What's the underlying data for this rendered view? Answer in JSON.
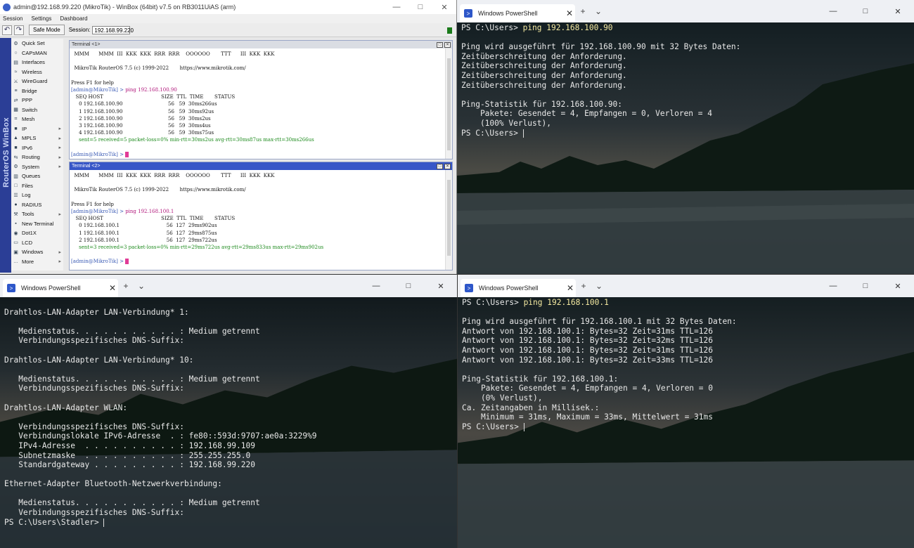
{
  "winbox": {
    "title": "admin@192.168.99.220 (MikroTik) - WinBox (64bit) v7.5 on RB3011UiAS (arm)",
    "menu": [
      "Session",
      "Settings",
      "Dashboard"
    ],
    "safe_mode_label": "Safe Mode",
    "session_label": "Session:",
    "session_value": "192.168.99.220",
    "vertical_label": "RouterOS WinBox",
    "sidebar": [
      {
        "label": "Quick Set",
        "icon": "quick-set-icon"
      },
      {
        "label": "CAPsMAN",
        "icon": "capsman-icon"
      },
      {
        "label": "Interfaces",
        "icon": "interfaces-icon"
      },
      {
        "label": "Wireless",
        "icon": "wireless-icon"
      },
      {
        "label": "WireGuard",
        "icon": "wireguard-icon"
      },
      {
        "label": "Bridge",
        "icon": "bridge-icon"
      },
      {
        "label": "PPP",
        "icon": "ppp-icon"
      },
      {
        "label": "Switch",
        "icon": "switch-icon"
      },
      {
        "label": "Mesh",
        "icon": "mesh-icon"
      },
      {
        "label": "IP",
        "icon": "ip-icon",
        "arrow": true
      },
      {
        "label": "MPLS",
        "icon": "mpls-icon",
        "arrow": true
      },
      {
        "label": "IPv6",
        "icon": "ipv6-icon",
        "arrow": true
      },
      {
        "label": "Routing",
        "icon": "routing-icon",
        "arrow": true
      },
      {
        "label": "System",
        "icon": "system-icon",
        "arrow": true
      },
      {
        "label": "Queues",
        "icon": "queues-icon"
      },
      {
        "label": "Files",
        "icon": "files-icon"
      },
      {
        "label": "Log",
        "icon": "log-icon"
      },
      {
        "label": "RADIUS",
        "icon": "radius-icon"
      },
      {
        "label": "Tools",
        "icon": "tools-icon",
        "arrow": true
      },
      {
        "label": "New Terminal",
        "icon": "new-terminal-icon"
      },
      {
        "label": "Dot1X",
        "icon": "dot1x-icon"
      },
      {
        "label": "LCD",
        "icon": "lcd-icon"
      },
      {
        "label": "Windows",
        "icon": "windows-icon",
        "arrow": true
      },
      {
        "label": "More",
        "icon": "more-icon",
        "arrow": true
      }
    ],
    "terminal1": {
      "title": "Terminal <1>",
      "banner": "  MMM      MMM  III  KKK  KKK  RRR  RRR    OOOOOO       TTT      III  KKK  KKK",
      "version": "  MikroTik RouterOS 7.5 (c) 1999-2022       https://www.mikrotik.com/",
      "help": "Press F1 for help",
      "prompt": "[admin@MikroTik] > ",
      "command": "ping 192.168.100.90",
      "header": "   SEQ HOST                                     SIZE  TTL  TIME       STATUS",
      "rows": [
        "     0 192.168.100.90                             56   59  30ms266us",
        "     1 192.168.100.90                             56   59  30ms92us",
        "     2 192.168.100.90                             56   59  30ms2us",
        "     3 192.168.100.90                             56   59  30ms4us",
        "     4 192.168.100.90                             56   59  30ms75us"
      ],
      "summary": "     sent=5 received=5 packet-loss=0% min-rtt=30ms2us avg-rtt=30ms87us max-rtt=30ms266us",
      "final_prompt": "[admin@MikroTik] > "
    },
    "terminal2": {
      "title": "Terminal <2>",
      "banner": "  MMM      MMM  III  KKK  KKK  RRR  RRR    OOOOOO       TTT      III  KKK  KKK",
      "version": "  MikroTik RouterOS 7.5 (c) 1999-2022       https://www.mikrotik.com/",
      "help": "Press F1 for help",
      "prompt": "[admin@MikroTik] > ",
      "command": "ping 192.168.100.1",
      "header": "   SEQ HOST                                     SIZE  TTL  TIME       STATUS",
      "rows": [
        "     0 192.168.100.1                              56  127  29ms902us",
        "     1 192.168.100.1                              56  127  29ms875us",
        "     2 192.168.100.1                              56  127  29ms722us"
      ],
      "summary": "     sent=3 received=3 packet-loss=0% min-rtt=29ms722us avg-rtt=29ms833us max-rtt=29ms902us",
      "final_prompt": "[admin@MikroTik] > "
    }
  },
  "ps1": {
    "tab_label": "Windows PowerShell",
    "prompt": "PS C:\\Users> ",
    "command": "ping 192.168.100.90",
    "output": [
      "",
      "Ping wird ausgeführt für 192.168.100.90 mit 32 Bytes Daten:",
      "Zeitüberschreitung der Anforderung.",
      "Zeitüberschreitung der Anforderung.",
      "Zeitüberschreitung der Anforderung.",
      "Zeitüberschreitung der Anforderung.",
      "",
      "Ping-Statistik für 192.168.100.90:",
      "    Pakete: Gesendet = 4, Empfangen = 0, Verloren = 4",
      "    (100% Verlust),"
    ],
    "final_prompt": "PS C:\\Users> "
  },
  "ps2": {
    "tab_label": "Windows PowerShell",
    "output": [
      "",
      "Drahtlos-LAN-Adapter LAN-Verbindung* 1:",
      "",
      "   Medienstatus. . . . . . . . . . . : Medium getrennt",
      "   Verbindungsspezifisches DNS-Suffix:",
      "",
      "Drahtlos-LAN-Adapter LAN-Verbindung* 10:",
      "",
      "   Medienstatus. . . . . . . . . . . : Medium getrennt",
      "   Verbindungsspezifisches DNS-Suffix:",
      "",
      "Drahtlos-LAN-Adapter WLAN:",
      "",
      "   Verbindungsspezifisches DNS-Suffix:",
      "   Verbindungslokale IPv6-Adresse  . : fe80::593d:9707:ae0a:3229%9",
      "   IPv4-Adresse  . . . . . . . . . . : 192.168.99.109",
      "   Subnetzmaske  . . . . . . . . . . : 255.255.255.0",
      "   Standardgateway . . . . . . . . . : 192.168.99.220",
      "",
      "Ethernet-Adapter Bluetooth-Netzwerkverbindung:",
      "",
      "   Medienstatus. . . . . . . . . . . : Medium getrennt",
      "   Verbindungsspezifisches DNS-Suffix:"
    ],
    "final_prompt": "PS C:\\Users\\Stadler> "
  },
  "ps3": {
    "tab_label": "Windows PowerShell",
    "prompt": "PS C:\\Users> ",
    "command": "ping 192.168.100.1",
    "output": [
      "",
      "Ping wird ausgeführt für 192.168.100.1 mit 32 Bytes Daten:",
      "Antwort von 192.168.100.1: Bytes=32 Zeit=31ms TTL=126",
      "Antwort von 192.168.100.1: Bytes=32 Zeit=32ms TTL=126",
      "Antwort von 192.168.100.1: Bytes=32 Zeit=31ms TTL=126",
      "Antwort von 192.168.100.1: Bytes=32 Zeit=33ms TTL=126",
      "",
      "Ping-Statistik für 192.168.100.1:",
      "    Pakete: Gesendet = 4, Empfangen = 4, Verloren = 0",
      "    (0% Verlust),",
      "Ca. Zeitangaben in Millisek.:",
      "    Minimum = 31ms, Maximum = 33ms, Mittelwert = 31ms"
    ],
    "final_prompt": "PS C:\\Users> "
  }
}
